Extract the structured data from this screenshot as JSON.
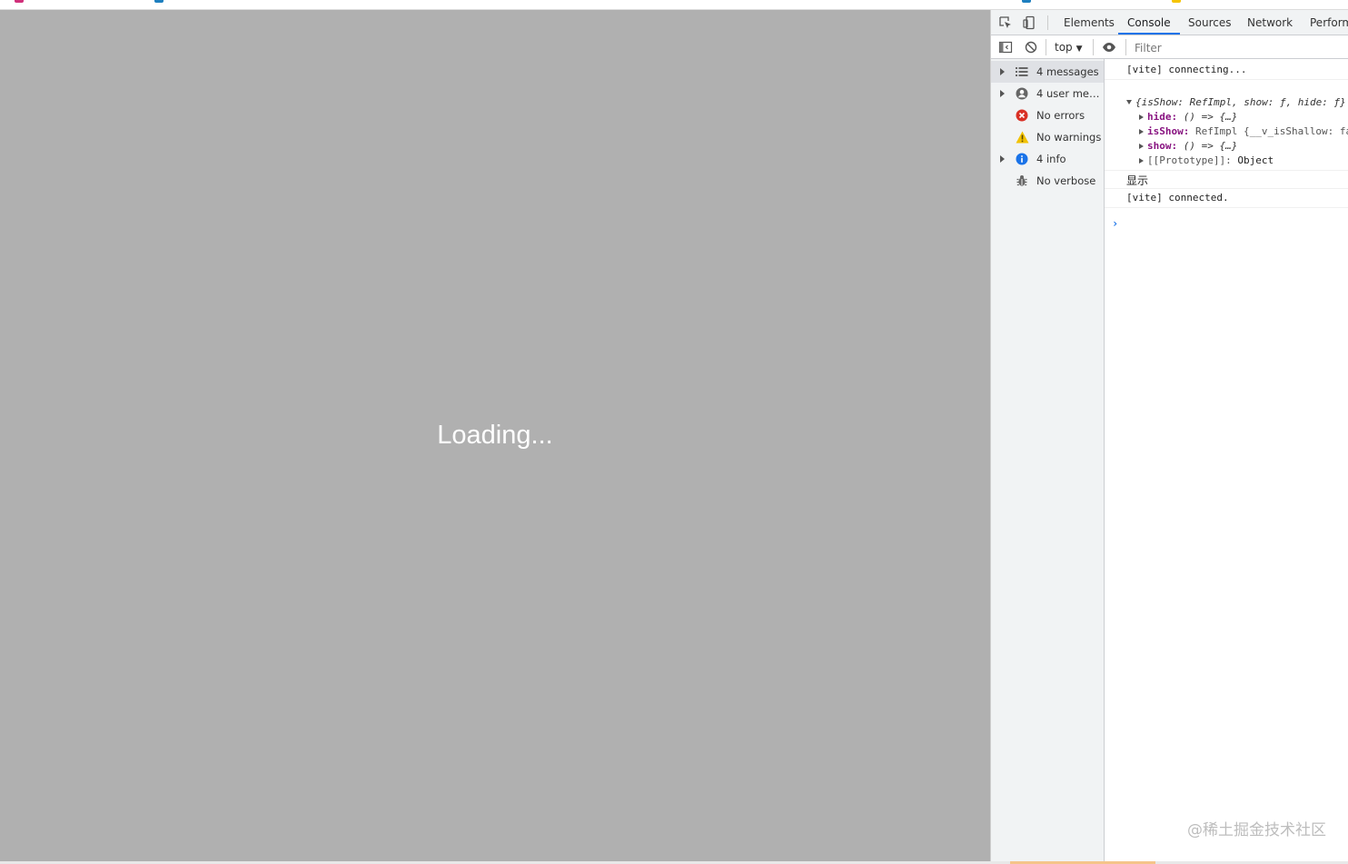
{
  "page": {
    "loading_text": "Loading..."
  },
  "devtools": {
    "tabs": [
      {
        "label": "Elements"
      },
      {
        "label": "Console"
      },
      {
        "label": "Sources"
      },
      {
        "label": "Network"
      },
      {
        "label": "Perform"
      }
    ],
    "active_tab": "Console",
    "toolbar": {
      "context": "top",
      "filter_placeholder": "Filter"
    },
    "sidebar": [
      {
        "label": "4 messages",
        "icon": "list-icon",
        "expandable": true,
        "selected": true
      },
      {
        "label": "4 user mess...",
        "icon": "user-icon",
        "expandable": true,
        "selected": false
      },
      {
        "label": "No errors",
        "icon": "error-icon",
        "expandable": false,
        "selected": false
      },
      {
        "label": "No warnings",
        "icon": "warning-icon",
        "expandable": false,
        "selected": false
      },
      {
        "label": "4 info",
        "icon": "info-icon",
        "expandable": true,
        "selected": false
      },
      {
        "label": "No verbose",
        "icon": "bug-icon",
        "expandable": false,
        "selected": false
      }
    ],
    "console": {
      "line1": "[vite] connecting...",
      "object_preview": "{isShow: RefImpl, show: ƒ, hide: ƒ}",
      "props": [
        {
          "key": "hide:",
          "value": "() => {…}",
          "italic": true
        },
        {
          "key": "isShow:",
          "value": "RefImpl {__v_isShallow: fa",
          "italic": false
        },
        {
          "key": "show:",
          "value": "() => {…}",
          "italic": true
        },
        {
          "key": "[[Prototype]]:",
          "value": "Object",
          "italic": false,
          "internal": true
        }
      ],
      "line3": "显示",
      "line4": "[vite] connected."
    },
    "watermark": "@稀土掘金技术社区"
  },
  "colors": {
    "page_background": "#b0b0b0",
    "accent": "#1a73e8",
    "error": "#d93025",
    "warning": "#f2c200",
    "info": "#1a73e8"
  }
}
